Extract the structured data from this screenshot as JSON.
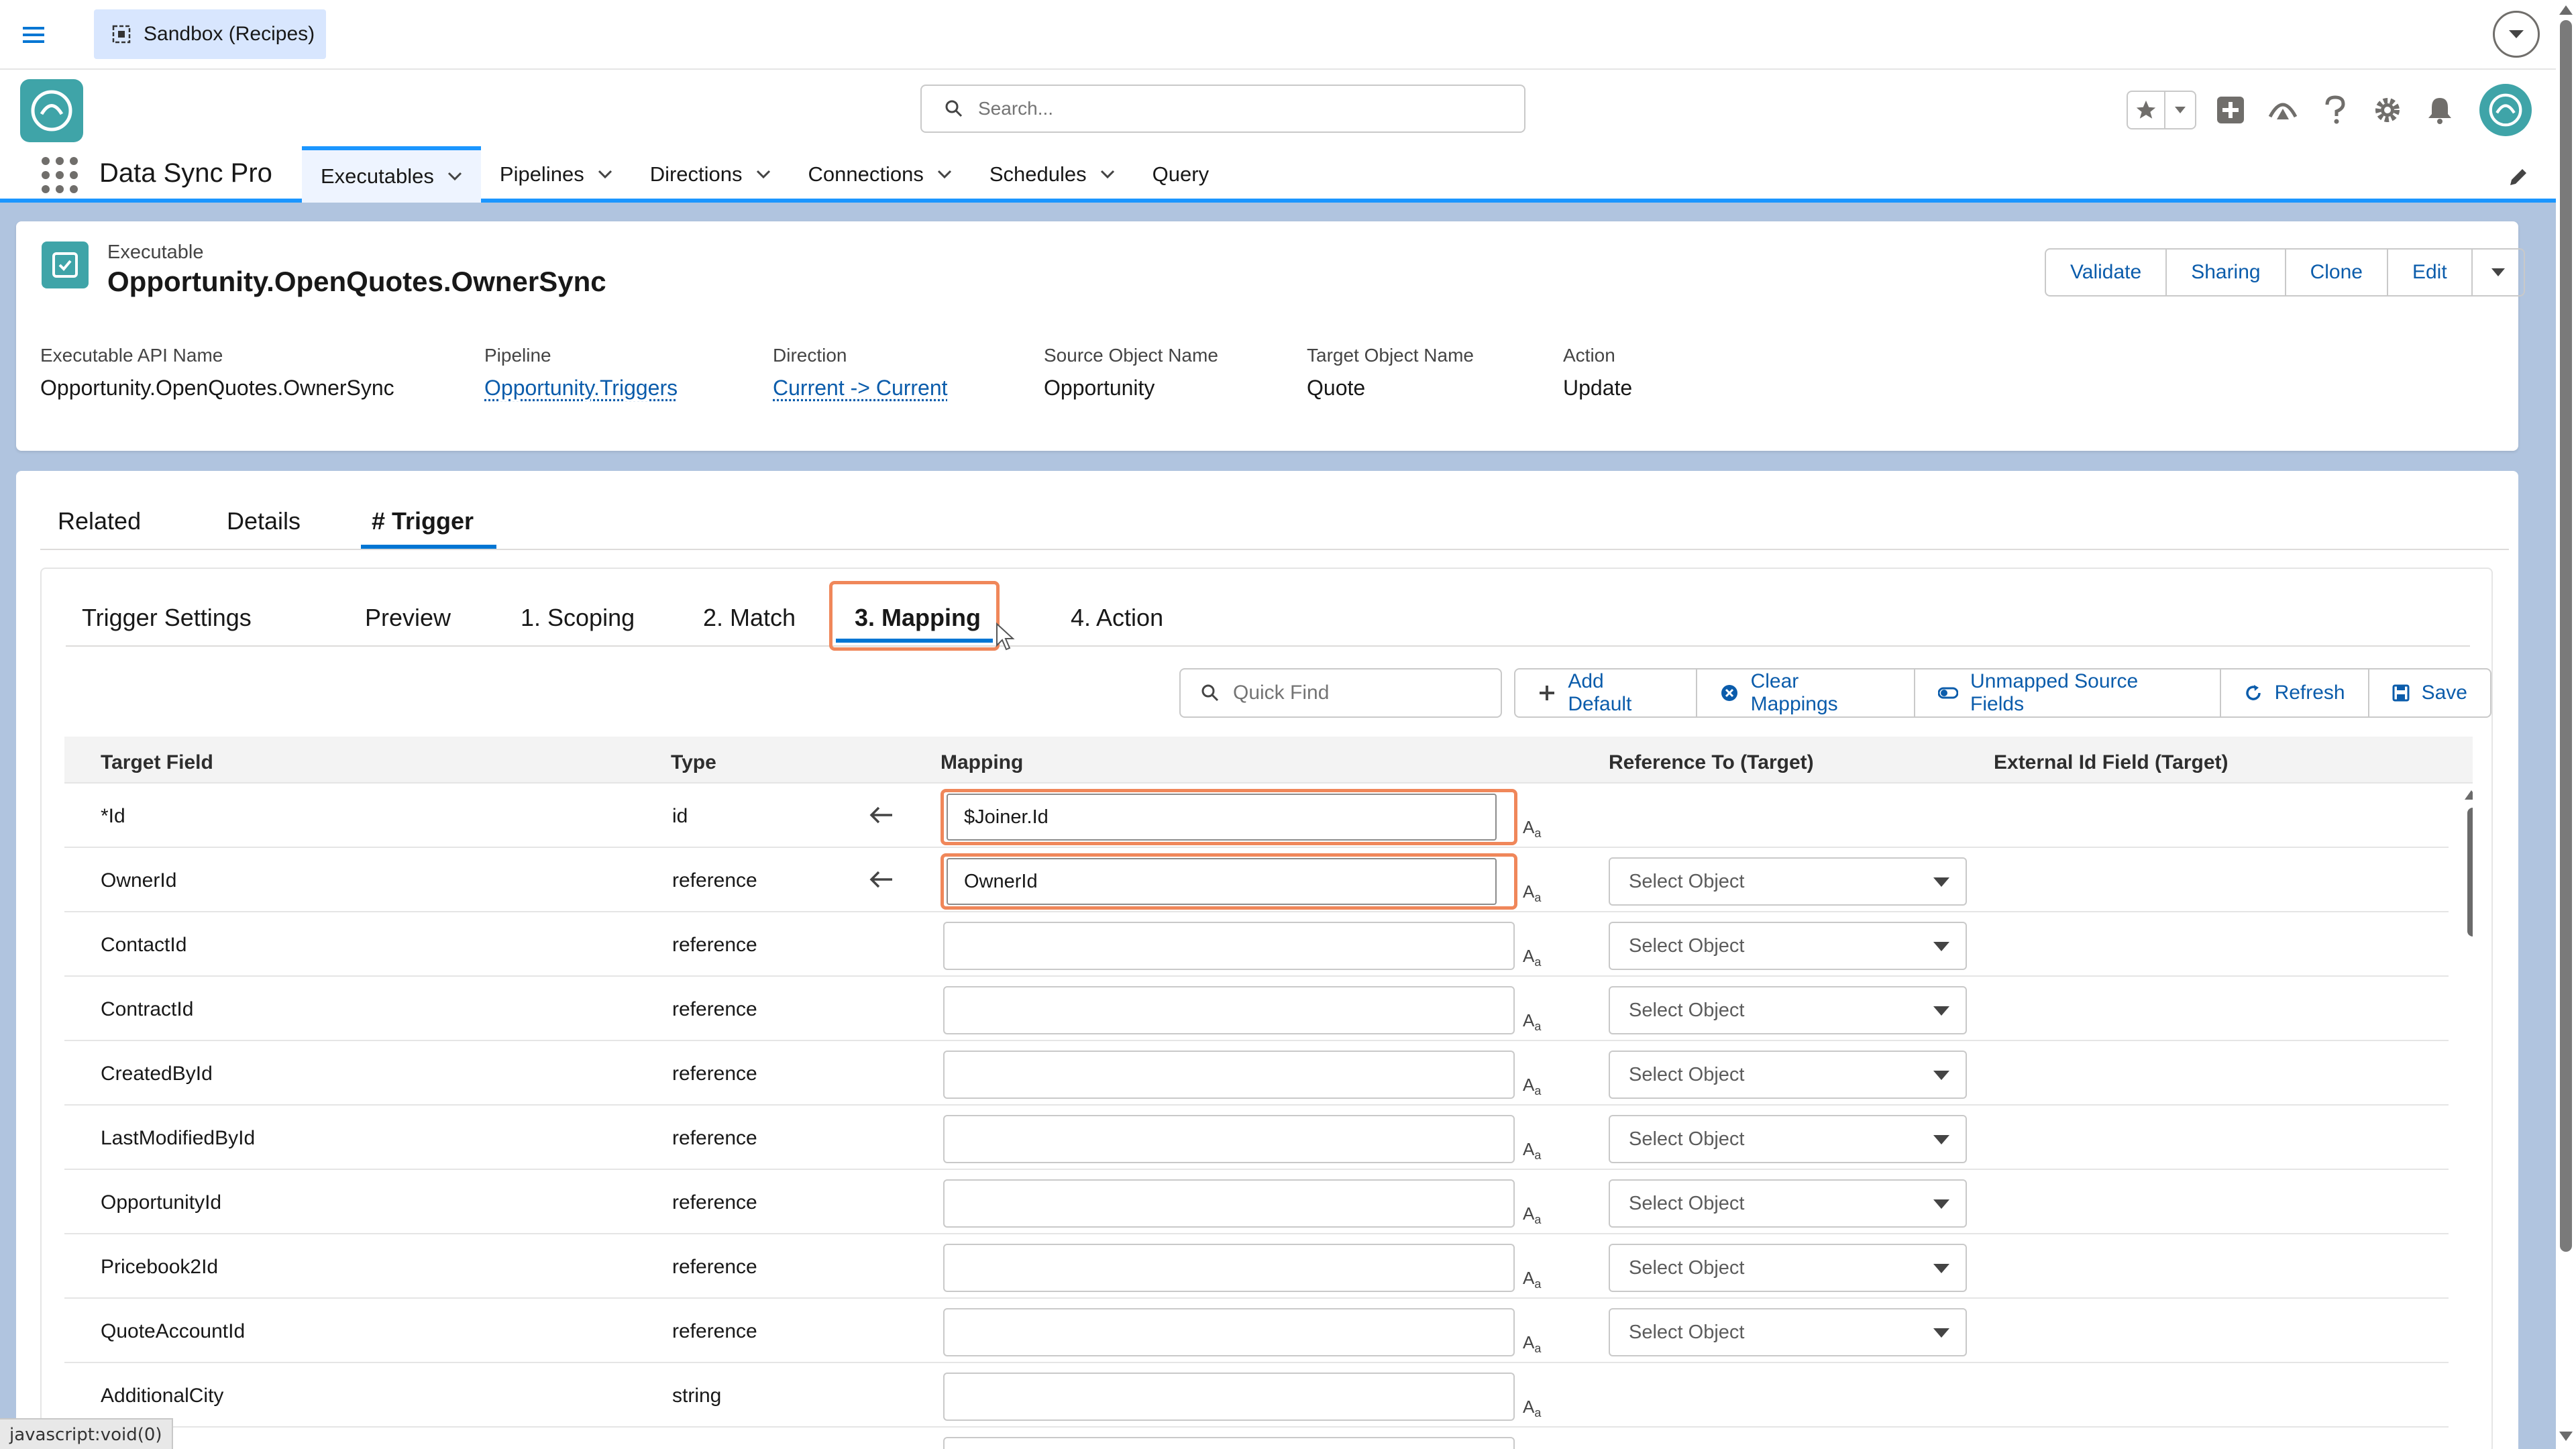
{
  "topbar": {
    "sandbox_label": "Sandbox (Recipes)"
  },
  "header": {
    "search_placeholder": "Search...",
    "app_name": "Data Sync Pro",
    "nav": [
      {
        "label": "Executables"
      },
      {
        "label": "Pipelines"
      },
      {
        "label": "Directions"
      },
      {
        "label": "Connections"
      },
      {
        "label": "Schedules"
      },
      {
        "label": "Query"
      }
    ]
  },
  "record": {
    "type": "Executable",
    "title": "Opportunity.OpenQuotes.OwnerSync",
    "actions": {
      "validate": "Validate",
      "sharing": "Sharing",
      "clone": "Clone",
      "edit": "Edit"
    },
    "fields": [
      {
        "label": "Executable API Name",
        "value": "Opportunity.OpenQuotes.OwnerSync"
      },
      {
        "label": "Pipeline",
        "value": "Opportunity.Triggers"
      },
      {
        "label": "Direction",
        "value": "Current -> Current"
      },
      {
        "label": "Source Object Name",
        "value": "Opportunity"
      },
      {
        "label": "Target Object Name",
        "value": "Quote"
      },
      {
        "label": "Action",
        "value": "Update"
      }
    ]
  },
  "tabs": {
    "related": "Related",
    "details": "Details",
    "trigger": "# Trigger"
  },
  "subtabs": {
    "trigger_settings": "Trigger Settings",
    "preview": "Preview",
    "scoping": "1. Scoping",
    "match": "2. Match",
    "mapping": "3. Mapping",
    "action": "4. Action"
  },
  "toolbar": {
    "quick_find_placeholder": "Quick Find",
    "add_default": "Add Default",
    "clear_mappings": "Clear Mappings",
    "unmapped_source_fields": "Unmapped Source Fields",
    "refresh": "Refresh",
    "save": "Save"
  },
  "table": {
    "headers": {
      "target_field": "Target Field",
      "type": "Type",
      "mapping": "Mapping",
      "reference_to": "Reference To (Target)",
      "external_id": "External Id Field (Target)"
    },
    "select_placeholder": "Select Object",
    "aa_icon": "Aa",
    "rows": [
      {
        "field": "*Id",
        "type": "id",
        "mapping": "$Joiner.Id",
        "arrow": true,
        "select": false
      },
      {
        "field": "OwnerId",
        "type": "reference",
        "mapping": "OwnerId",
        "arrow": true,
        "select": true
      },
      {
        "field": "ContactId",
        "type": "reference",
        "mapping": "",
        "arrow": false,
        "select": true
      },
      {
        "field": "ContractId",
        "type": "reference",
        "mapping": "",
        "arrow": false,
        "select": true
      },
      {
        "field": "CreatedById",
        "type": "reference",
        "mapping": "",
        "arrow": false,
        "select": true
      },
      {
        "field": "LastModifiedById",
        "type": "reference",
        "mapping": "",
        "arrow": false,
        "select": true
      },
      {
        "field": "OpportunityId",
        "type": "reference",
        "mapping": "",
        "arrow": false,
        "select": true
      },
      {
        "field": "Pricebook2Id",
        "type": "reference",
        "mapping": "",
        "arrow": false,
        "select": true
      },
      {
        "field": "QuoteAccountId",
        "type": "reference",
        "mapping": "",
        "arrow": false,
        "select": true
      },
      {
        "field": "AdditionalCity",
        "type": "string",
        "mapping": "",
        "arrow": false,
        "select": false
      },
      {
        "field": "",
        "type": "",
        "mapping": "",
        "arrow": false,
        "select": false
      }
    ]
  },
  "status_bar": "javascript:void(0)",
  "colors": {
    "brand_blue": "#0176d3",
    "link_blue": "#0b5cab",
    "highlight_orange": "#f0875a",
    "teal": "#3fa4a8"
  }
}
